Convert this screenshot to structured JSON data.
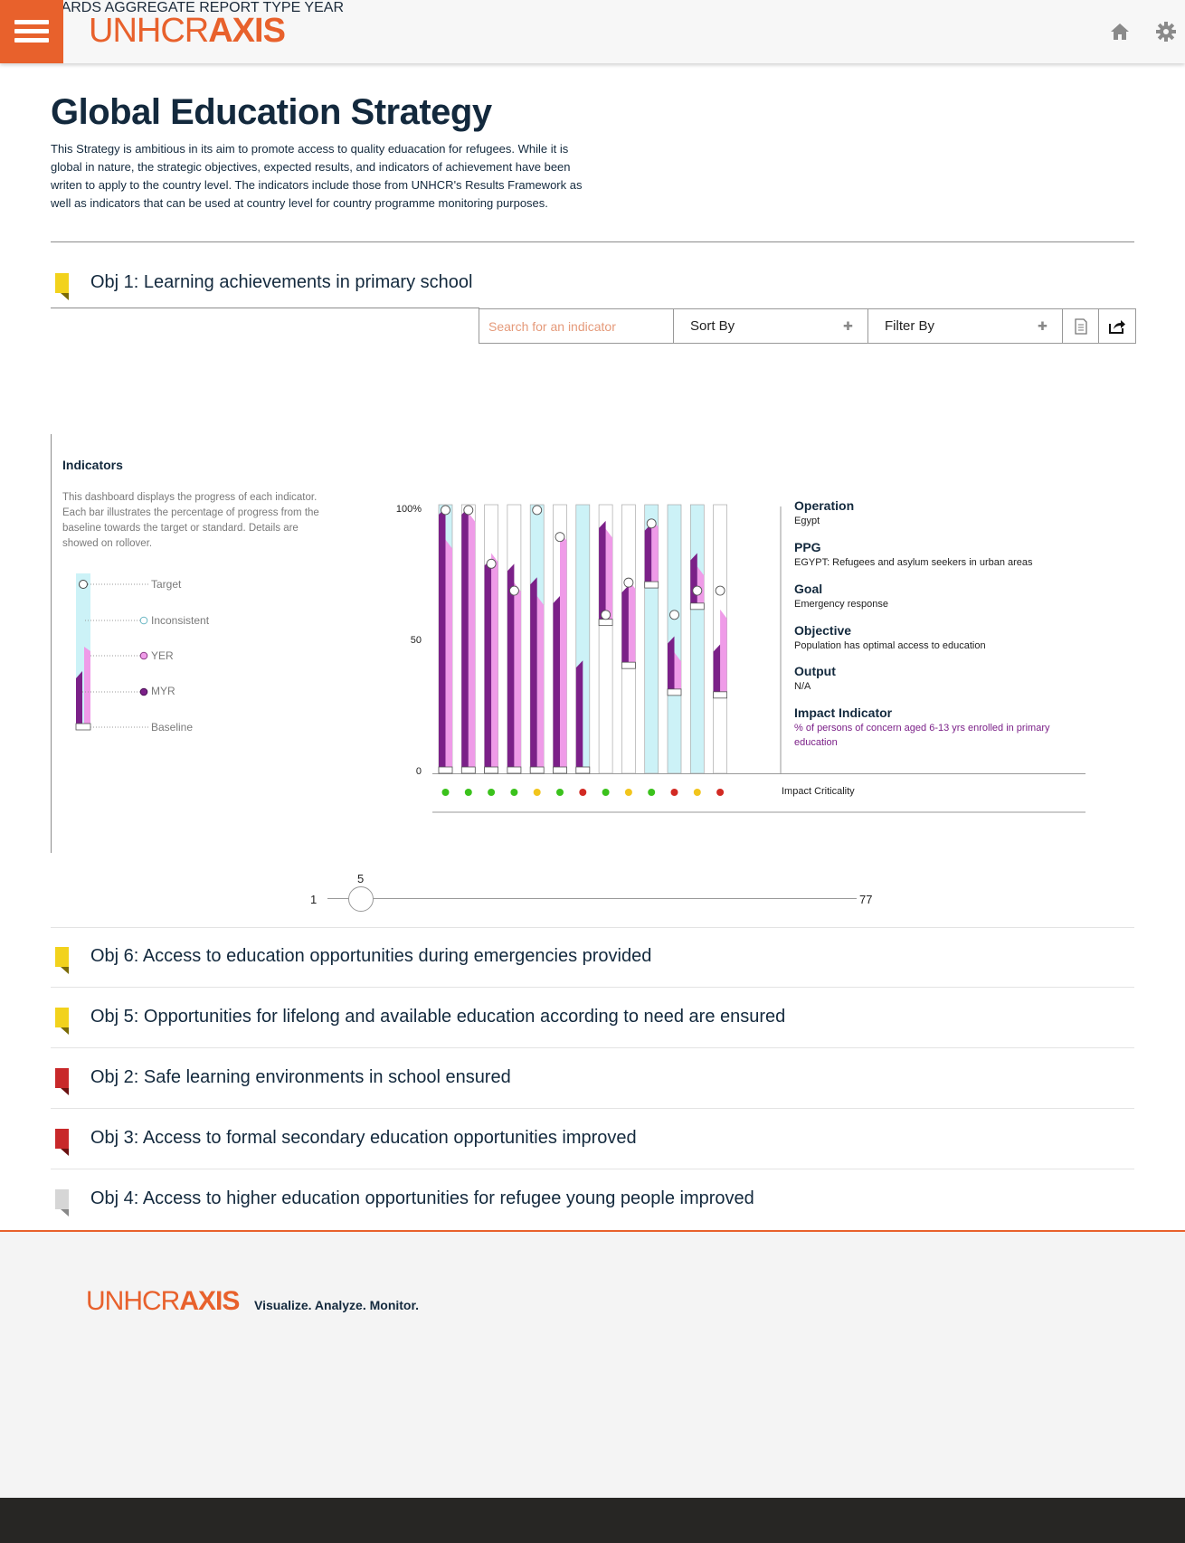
{
  "header": {
    "logo_light": "UNHCR",
    "logo_bold": "AXIS",
    "nav": [
      "DASHBOARDS",
      "AGGREGATE",
      "REPORT TYPE",
      "YEAR"
    ]
  },
  "page": {
    "title": "Global Education Strategy",
    "intro": "This Strategy is ambitious in its aim to promote access to quality eduacation for refugees. While it is global in nature, the strategic objectives, expected results, and indicators of achievement have been writen to apply to the country level. The indicators include those from UNHCR's Results Framework as well as indicators that can be used at country level for country programme monitoring purposes."
  },
  "objective_main": {
    "title": "Obj 1: Learning achievements in primary school",
    "flag_color": "#f2d21c"
  },
  "toolbar": {
    "search_placeholder": "Search for an indicator",
    "sort_label": "Sort By",
    "filter_label": "Filter By"
  },
  "indicators": {
    "title": "Indicators",
    "description": "This dashboard displays the progress of each indicator. Each bar illustrates the percentage of progress from the baseline towards the target or standard. Details are showed on rollover.",
    "legend": [
      "Target",
      "Inconsistent",
      "YER",
      "MYR",
      "Baseline"
    ]
  },
  "colors": {
    "myr": "#7b2088",
    "yer": "#ef9be8",
    "inconsistent": "#ccf2f7",
    "green": "#3bc21c",
    "yellow": "#f2c51c",
    "red": "#d22a23",
    "accent": "#e8612c"
  },
  "chart_data": {
    "type": "bar",
    "y_ticks": [
      "100%",
      "50",
      "0"
    ],
    "ylim": [
      0,
      100
    ],
    "x_label": "Impact Criticality",
    "bars": [
      {
        "inconsistent": true,
        "myr": 99,
        "yer": 87,
        "baseline": 0,
        "target": 98,
        "criticality": "green"
      },
      {
        "inconsistent": false,
        "myr": 99,
        "yer": 97,
        "baseline": 0,
        "target": 98,
        "criticality": "green"
      },
      {
        "inconsistent": false,
        "myr": 80,
        "yer": 82,
        "baseline": 0,
        "target": 78,
        "criticality": "green"
      },
      {
        "inconsistent": false,
        "myr": 78,
        "yer": 71,
        "baseline": 0,
        "target": 68,
        "criticality": "green"
      },
      {
        "inconsistent": true,
        "myr": 73,
        "yer": 66,
        "baseline": 0,
        "target": 98,
        "criticality": "yellow"
      },
      {
        "inconsistent": false,
        "myr": 66,
        "yer": 90,
        "baseline": 0,
        "target": 88,
        "criticality": "green"
      },
      {
        "inconsistent": true,
        "myr": 42,
        "yer": 0,
        "baseline": 0,
        "target": null,
        "criticality": "red"
      },
      {
        "inconsistent": false,
        "myr": 94,
        "yer": 91,
        "baseline": 55,
        "target": 59,
        "criticality": "green"
      },
      {
        "inconsistent": false,
        "myr": 70,
        "yer": 72,
        "baseline": 39,
        "target": 71,
        "criticality": "yellow"
      },
      {
        "inconsistent": true,
        "myr": 93,
        "yer": 95,
        "baseline": 69,
        "target": 93,
        "criticality": "green"
      },
      {
        "inconsistent": true,
        "myr": 51,
        "yer": 45,
        "baseline": 29,
        "target": 59,
        "criticality": "red"
      },
      {
        "inconsistent": true,
        "myr": 82,
        "yer": 77,
        "baseline": 61,
        "target": 68,
        "criticality": "yellow"
      },
      {
        "inconsistent": false,
        "myr": 48,
        "yer": 61,
        "baseline": 28,
        "target": 68,
        "criticality": "red"
      }
    ]
  },
  "details": [
    {
      "label": "Operation",
      "value": "Egypt"
    },
    {
      "label": "PPG",
      "value": "EGYPT: Refugees and asylum seekers in urban areas"
    },
    {
      "label": "Goal",
      "value": "Emergency response"
    },
    {
      "label": "Objective",
      "value": "Population has optimal access to education"
    },
    {
      "label": "Output",
      "value": "N/A"
    },
    {
      "label": "Impact Indicator",
      "value": "% of persons of concern aged 6-13 yrs enrolled in primary education"
    }
  ],
  "slider": {
    "min": "1",
    "max": "77",
    "value": "5"
  },
  "objectives": [
    {
      "title": "Obj 6: Access to education opportunities during emergencies provided",
      "flag_color": "#f2d21c"
    },
    {
      "title": "Obj 5: Opportunities for lifelong and available education according to need are ensured",
      "flag_color": "#f2d21c"
    },
    {
      "title": "Obj 2: Safe learning environments in school ensured",
      "flag_color": "#c8282a"
    },
    {
      "title": "Obj 3: Access to formal secondary education opportunities improved",
      "flag_color": "#c8282a"
    },
    {
      "title": "Obj 4: Access to higher education opportunities for refugee young people improved",
      "flag_color": "#d6d6d6"
    }
  ],
  "footer": {
    "logo_light": "UNHCR",
    "logo_bold": "AXIS",
    "tagline": "Visualize. Analyze. Monitor."
  }
}
